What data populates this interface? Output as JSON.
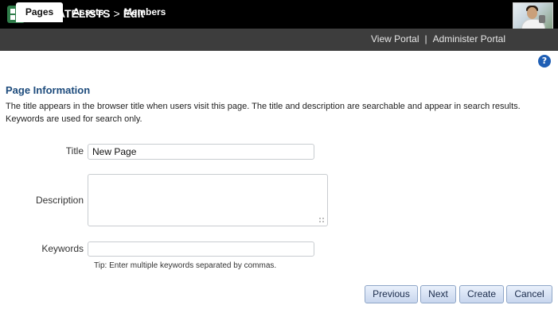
{
  "header": {
    "app_name": "PHILATELISTS",
    "separator": ">",
    "page": "Edit"
  },
  "tabs": [
    {
      "label": "Pages",
      "active": true
    },
    {
      "label": "Assets",
      "active": false
    },
    {
      "label": "Members",
      "active": false
    }
  ],
  "links": {
    "view_portal": "View Portal",
    "separator": "|",
    "administer_portal": "Administer Portal"
  },
  "help_glyph": "?",
  "section": {
    "title": "Page Information",
    "description": "The title appears in the browser title when users visit this page. The title and description are searchable and appear in search results. Keywords are used for search only."
  },
  "form": {
    "title_label": "Title",
    "title_value": "New Page",
    "description_label": "Description",
    "description_value": "",
    "keywords_label": "Keywords",
    "keywords_value": "",
    "keywords_tip": "Tip: Enter multiple keywords separated by commas."
  },
  "buttons": {
    "previous": "Previous",
    "next": "Next",
    "create": "Create",
    "cancel": "Cancel"
  },
  "colors": {
    "header_bg": "#000000",
    "tabbar_bg": "#3d3d3d",
    "section_title": "#1d4b7c",
    "help_icon": "#1f5fb5",
    "button_border": "#8fa6c7"
  },
  "icons": {
    "logo": "grid-logo-icon",
    "help": "help-icon",
    "avatar": "user-avatar-photo"
  }
}
